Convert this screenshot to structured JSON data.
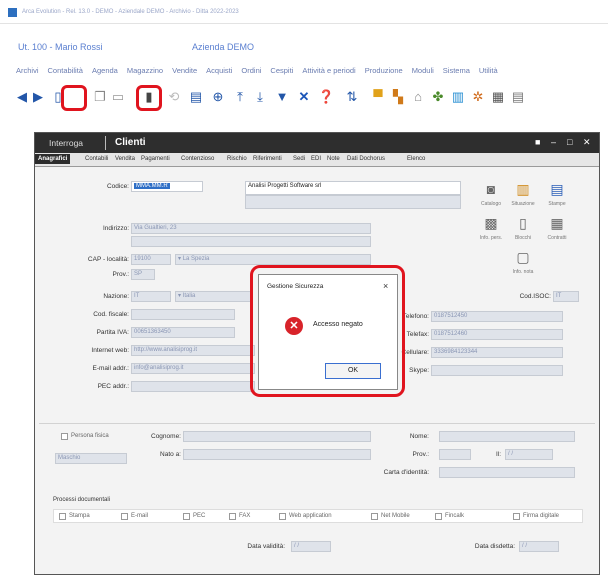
{
  "window": {
    "title": "Arca Evolution - Rel. 13.0 - DEMO - Aziendale DEMO - Archivio - Ditta 2022-2023"
  },
  "header": {
    "user": "Ut. 100 - Mario Rossi",
    "company": "Azienda DEMO"
  },
  "menu": [
    "Archivi",
    "Contabilità",
    "Agenda",
    "Magazzino",
    "Vendite",
    "Acquisti",
    "Ordini",
    "Cespiti",
    "Attività e periodi",
    "Produzione",
    "Moduli",
    "Sistema",
    "Utilità"
  ],
  "form": {
    "mode": "Interroga",
    "title": "Clienti",
    "tabs": [
      "Anagrafici",
      "Contabili",
      "Vendita",
      "Pagamenti",
      "Contenzioso",
      "Rischio",
      "Riferimenti",
      "Sedi",
      "EDI",
      "Note",
      "Dati Dochorus",
      "Elenco"
    ],
    "fields": {
      "codice_label": "Codice:",
      "codice": "MMA.MM.R",
      "ragione": "Analisi Progetti Software srl",
      "indirizzo_label": "Indirizzo:",
      "indirizzo": "Via Gualtieri, 23",
      "cap_label": "CAP - località:",
      "cap": "19100",
      "localita": "La Spezia",
      "prov_label": "Prov.:",
      "prov": "SP",
      "nazione_label": "Nazione:",
      "nazione_code": "IT",
      "nazione": "Italia",
      "cod_fiscale_label": "Cod. fiscale:",
      "piva_label": "Partita IVA:",
      "piva": "00651363450",
      "internet_label": "Internet web:",
      "internet": "http://www.analisiprog.it",
      "email_label": "E-mail addr.:",
      "email": "info@analisiprog.it",
      "pec_label": "PEC addr.:",
      "cod_isoc_label": "Cod.ISOC:",
      "cod_isoc": "IT",
      "telefono_label": "Telefono:",
      "telefono": "0187512450",
      "telefax_label": "Telefax:",
      "telefax": "0187512460",
      "cellulare_label": "Cellulare:",
      "cellulare": "3336984123344",
      "skype_label": "Skype:",
      "persona_fisica": "Persona fisica",
      "sesso": "Maschio",
      "cognome_label": "Cognome:",
      "nato_label": "Nato a:",
      "nome_label": "Nome:",
      "prov2_label": "Prov.:",
      "il_label": "Il:",
      "il_value": "/ /",
      "carta_label": "Carta d'identità:",
      "invio_label": "Processi documentali",
      "invio": [
        "Stampa",
        "E-mail",
        "PEC",
        "FAX",
        "Web application",
        "Net Mobile",
        "Fincalk",
        "Firma digitale"
      ],
      "data_validita_label": "Data validità:",
      "data_validita": "/ /",
      "data_disdetta_label": "Data disdetta:",
      "data_disdetta": "/ /"
    },
    "side_icons": [
      {
        "icon": "camera-icon",
        "label": "Catalogo"
      },
      {
        "icon": "chart-icon",
        "label": "Situazione"
      },
      {
        "icon": "printer-icon",
        "label": "Stampe"
      },
      {
        "icon": "document-icon",
        "label": "Info. pers."
      },
      {
        "icon": "book-icon",
        "label": "Blocchi"
      },
      {
        "icon": "grid-icon",
        "label": "Contratti"
      },
      {
        "icon": "page-icon",
        "label": "Info. nota"
      }
    ]
  },
  "dialog": {
    "title": "Gestione Sicurezza",
    "message": "Accesso negato",
    "ok": "OK",
    "close": "×"
  }
}
